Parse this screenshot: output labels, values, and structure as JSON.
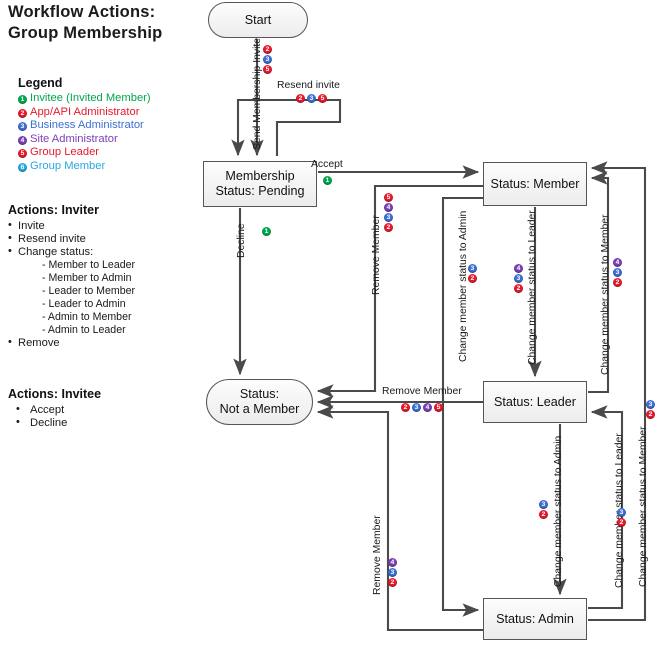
{
  "title": "Workflow  Actions:\nGroup Membership",
  "legend": {
    "heading": "Legend",
    "items": [
      {
        "num": "1",
        "label": "Invitee (Invited Member)",
        "color": "#00a64f"
      },
      {
        "num": "2",
        "label": "App/API Administrator",
        "color": "#e8192c"
      },
      {
        "num": "3",
        "label": "Business Administrator",
        "color": "#3b6fd4"
      },
      {
        "num": "4",
        "label": "Site Administrator",
        "color": "#7b3fb5"
      },
      {
        "num": "5",
        "label": "Group Leader",
        "color": "#e8192c"
      },
      {
        "num": "6",
        "label": "Group Member",
        "color": "#29a8e0"
      }
    ]
  },
  "actions_inviter": {
    "heading": "Actions: Inviter",
    "bullets": [
      "Invite",
      "Resend invite",
      "Change status:"
    ],
    "sub_items": [
      "- Member to Leader",
      "- Member to Admin",
      "- Leader to Member",
      "- Leader to Admin",
      "- Admin to Member",
      "- Admin to Leader"
    ],
    "last_bullet": "Remove"
  },
  "actions_invitee": {
    "heading": "Actions: Invitee",
    "bullets": [
      "Accept",
      "Decline"
    ]
  },
  "nodes": {
    "start": "Start",
    "pending": "Membership\nStatus: Pending",
    "member": "Status: Member",
    "leader": "Status: Leader",
    "admin": "Status: Admin",
    "not_member": "Status:\nNot a Member"
  },
  "edges": [
    {
      "id": "send-invite",
      "label": "Send Membership Invite",
      "badges": [
        "2",
        "3",
        "5"
      ]
    },
    {
      "id": "resend-invite",
      "label": "Resend invite",
      "badges": [
        "2",
        "3",
        "5"
      ]
    },
    {
      "id": "accept",
      "label": "Accept",
      "badges": [
        "1"
      ]
    },
    {
      "id": "decline",
      "label": "Decline",
      "badges": [
        "1"
      ]
    },
    {
      "id": "remove-member-top",
      "label": "Remove Member",
      "badges": [
        "5",
        "4",
        "3",
        "2"
      ]
    },
    {
      "id": "member-to-admin",
      "label": "Change member status to Admin",
      "badges": [
        "3",
        "2"
      ]
    },
    {
      "id": "member-to-leader",
      "label": "Change member status to Leader",
      "badges": [
        "4",
        "3",
        "2"
      ]
    },
    {
      "id": "leader-to-member",
      "label": "Change member status to Member",
      "badges": [
        "4",
        "3",
        "2"
      ]
    },
    {
      "id": "remove-member-mid",
      "label": "Remove Member",
      "badges": [
        "2",
        "3",
        "4",
        "5"
      ]
    },
    {
      "id": "admin-to-member",
      "label": "Change member status to Member",
      "badges": [
        "3",
        "2"
      ]
    },
    {
      "id": "leader-to-admin",
      "label": "Change member status to Admin",
      "badges": [
        "3",
        "2"
      ]
    },
    {
      "id": "admin-to-leader",
      "label": "Change member status to Leader",
      "badges": [
        "3",
        "2"
      ]
    },
    {
      "id": "remove-member-bot",
      "label": "Remove Member",
      "badges": [
        "4",
        "3",
        "2"
      ]
    }
  ]
}
